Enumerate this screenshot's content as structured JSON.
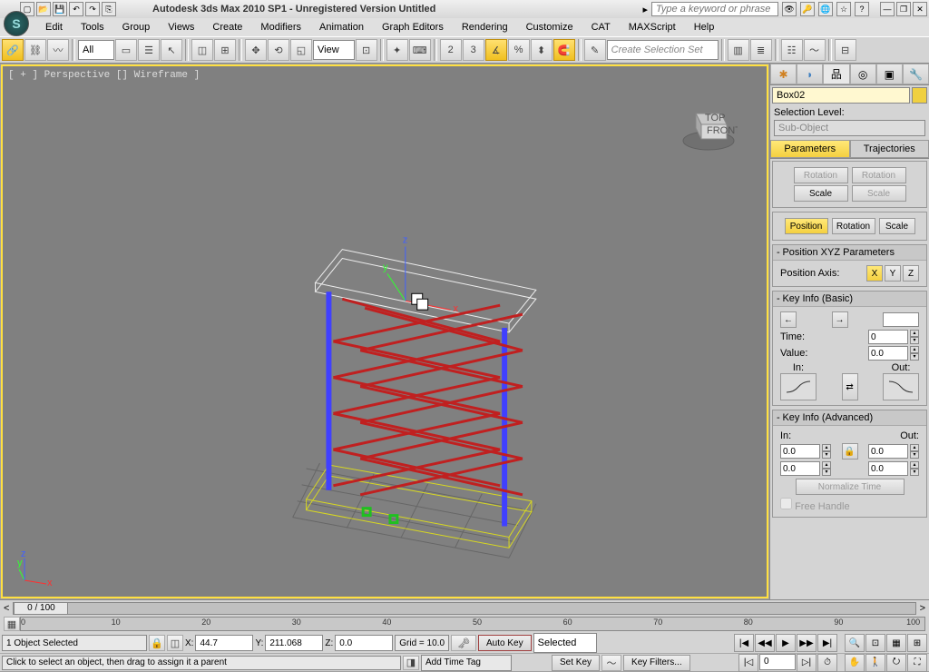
{
  "title": "Autodesk 3ds Max  2010 SP1 -  Unregistered Version   Untitled",
  "searchPlaceholder": "Type a keyword or phrase",
  "menu": [
    "Edit",
    "Tools",
    "Group",
    "Views",
    "Create",
    "Modifiers",
    "Animation",
    "Graph Editors",
    "Rendering",
    "Customize",
    "CAT",
    "MAXScript",
    "Help"
  ],
  "toolbar": {
    "selFilter": "All",
    "refCoord": "View",
    "namedSel": "Create Selection Set"
  },
  "viewport": {
    "label": "[ + ] Perspective [] Wireframe ]",
    "cubeTop": "TOP",
    "cubeFront": "FRONT"
  },
  "panel": {
    "objectName": "Box02",
    "selLevelLabel": "Selection Level:",
    "subObject": "Sub-Object",
    "tabs": {
      "params": "Parameters",
      "traj": "Trajectories"
    },
    "btns": {
      "rotation": "Rotation",
      "scale": "Scale",
      "position": "Position"
    },
    "posxyz": {
      "header": "Position XYZ Parameters",
      "axisLabel": "Position Axis:",
      "x": "X",
      "y": "Y",
      "z": "Z"
    },
    "keyBasic": {
      "header": "Key Info (Basic)",
      "time": "Time:",
      "timeVal": "0",
      "value": "Value:",
      "valueVal": "0.0",
      "in": "In:",
      "out": "Out:"
    },
    "keyAdv": {
      "header": "Key Info (Advanced)",
      "in": "In:",
      "out": "Out:",
      "inVal": "0.0",
      "outVal": "0.0",
      "inVal2": "0.0",
      "outVal2": "0.0",
      "normTime": "Normalize Time",
      "freeHandle": "Free Handle"
    }
  },
  "timeline": {
    "sliderLabel": "0 / 100",
    "ticks": [
      "0",
      "10",
      "20",
      "30",
      "40",
      "50",
      "60",
      "70",
      "80",
      "90",
      "100"
    ]
  },
  "status": {
    "selInfo": "1 Object Selected",
    "x": "44.7",
    "y": "211.068",
    "z": "0.0",
    "grid": "Grid = 10.0",
    "autoKey": "Auto Key",
    "setKey": "Set Key",
    "selected": "Selected",
    "keyFilters": "Key Filters...",
    "prompt": "Click to select an object, then drag to assign it a parent",
    "addTimeTag": "Add Time Tag"
  }
}
